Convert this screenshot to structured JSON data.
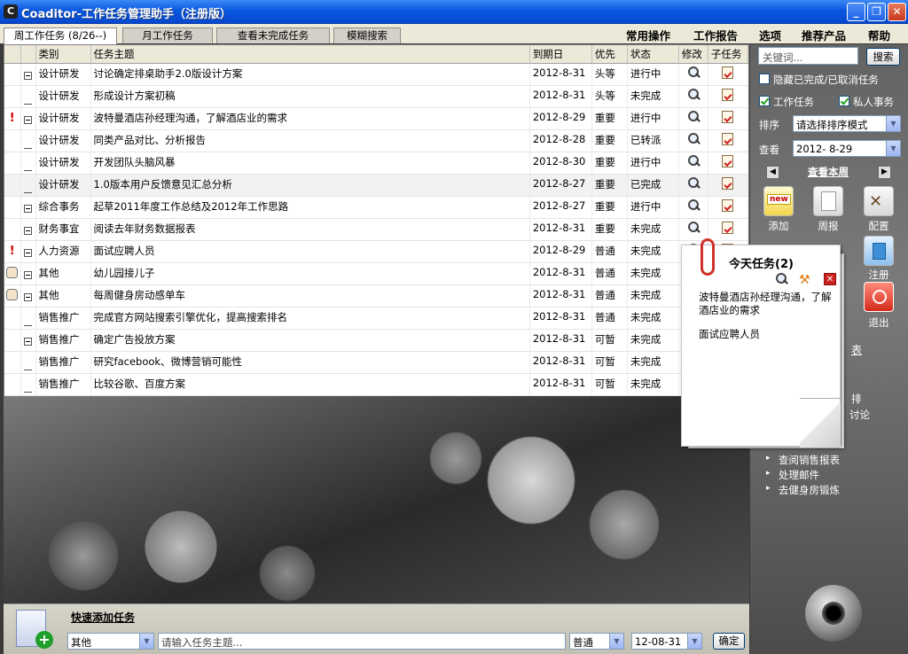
{
  "window": {
    "logo": "C",
    "title": "Coaditor-工作任务管理助手（注册版）"
  },
  "tabs": [
    {
      "label": "周工作任务 (8/26--)"
    },
    {
      "label": "月工作任务"
    },
    {
      "label": "查看未完成任务"
    },
    {
      "label": "模糊搜索"
    }
  ],
  "menus": [
    {
      "label": "常用操作"
    },
    {
      "label": "工作报告"
    },
    {
      "label": "选项"
    },
    {
      "label": "推荐产品"
    },
    {
      "label": "帮助"
    }
  ],
  "table": {
    "headers": [
      "类别",
      "任务主题",
      "到期日",
      "优先",
      "状态",
      "修改",
      "子任务"
    ],
    "rows": [
      {
        "mark": "",
        "exp": "minus",
        "category": "设计研发",
        "subject": "讨论确定排桌助手2.0版设计方案",
        "due": "2012-8-31",
        "priority": "头等",
        "status": "进行中"
      },
      {
        "mark": "",
        "exp": "dash",
        "category": "设计研发",
        "subject": "形成设计方案初稿",
        "due": "2012-8-31",
        "priority": "头等",
        "status": "未完成"
      },
      {
        "mark": "!",
        "exp": "minus",
        "category": "设计研发",
        "subject": "波特曼酒店孙经理沟通，了解酒店业的需求",
        "due": "2012-8-29",
        "priority": "重要",
        "status": "进行中"
      },
      {
        "mark": "",
        "exp": "dash",
        "category": "设计研发",
        "subject": "同类产品对比、分析报告",
        "due": "2012-8-28",
        "priority": "重要",
        "status": "已转派"
      },
      {
        "mark": "",
        "exp": "dash",
        "category": "设计研发",
        "subject": "开发团队头脑风暴",
        "due": "2012-8-30",
        "priority": "重要",
        "status": "进行中"
      },
      {
        "mark": "",
        "exp": "dash",
        "category": "设计研发",
        "subject": "1.0版本用户反馈意见汇总分析",
        "due": "2012-8-27",
        "priority": "重要",
        "status": "已完成"
      },
      {
        "mark": "",
        "exp": "minus",
        "category": "综合事务",
        "subject": "起草2011年度工作总结及2012年工作思路",
        "due": "2012-8-27",
        "priority": "重要",
        "status": "进行中"
      },
      {
        "mark": "",
        "exp": "minus",
        "category": "财务事宜",
        "subject": "阅读去年财务数据报表",
        "due": "2012-8-31",
        "priority": "重要",
        "status": "未完成"
      },
      {
        "mark": "!",
        "exp": "minus",
        "category": "人力资源",
        "subject": "面试应聘人员",
        "due": "2012-8-29",
        "priority": "普通",
        "status": "未完成"
      },
      {
        "mark": "hand",
        "exp": "minus",
        "category": "其他",
        "subject": "幼儿园接儿子",
        "due": "2012-8-31",
        "priority": "普通",
        "status": "未完成"
      },
      {
        "mark": "hand",
        "exp": "minus",
        "category": "其他",
        "subject": "每周健身房动感单车",
        "due": "2012-8-31",
        "priority": "普通",
        "status": "未完成"
      },
      {
        "mark": "",
        "exp": "dash",
        "category": "销售推广",
        "subject": "完成官方网站搜索引擎优化，提高搜索排名",
        "due": "2012-8-31",
        "priority": "普通",
        "status": "未完成"
      },
      {
        "mark": "",
        "exp": "minus",
        "category": "销售推广",
        "subject": "确定广告投放方案",
        "due": "2012-8-31",
        "priority": "可暂",
        "status": "未完成"
      },
      {
        "mark": "",
        "exp": "dash",
        "category": "销售推广",
        "subject": "研究facebook、微博营销可能性",
        "due": "2012-8-31",
        "priority": "可暂",
        "status": "未完成"
      },
      {
        "mark": "",
        "exp": "dash",
        "category": "销售推广",
        "subject": "比较谷歌、百度方案",
        "due": "2012-8-31",
        "priority": "可暂",
        "status": "未完成"
      }
    ]
  },
  "quick_add": {
    "title": "快速添加任务",
    "category": "其他",
    "subject_placeholder": "请输入任务主题...",
    "priority": "普通",
    "date": "12-08-31",
    "ok": "确定"
  },
  "right": {
    "search_placeholder": "关键词...",
    "search_btn": "搜索",
    "hide_done": "隐藏已完成/已取消任务",
    "work_tasks": "工作任务",
    "private_tasks": "私人事务",
    "sort_label": "排序",
    "sort_value": "请选择排序模式",
    "view_label": "查看",
    "view_value": "2012- 8-29",
    "week_link": "查看本周",
    "buttons": [
      {
        "label": "添加"
      },
      {
        "label": "周报"
      },
      {
        "label": "配置"
      },
      {
        "label": "注册"
      },
      {
        "label": "退出"
      }
    ],
    "partial_texts": [
      "表",
      "排",
      "讨论"
    ],
    "tasks": [
      "查阅销售报表",
      "处理邮件",
      "去健身房锻炼"
    ]
  },
  "today": {
    "title": "今天任务(2)",
    "items": [
      "波特曼酒店孙经理沟通，了解酒店业的需求",
      "面试应聘人员"
    ]
  }
}
